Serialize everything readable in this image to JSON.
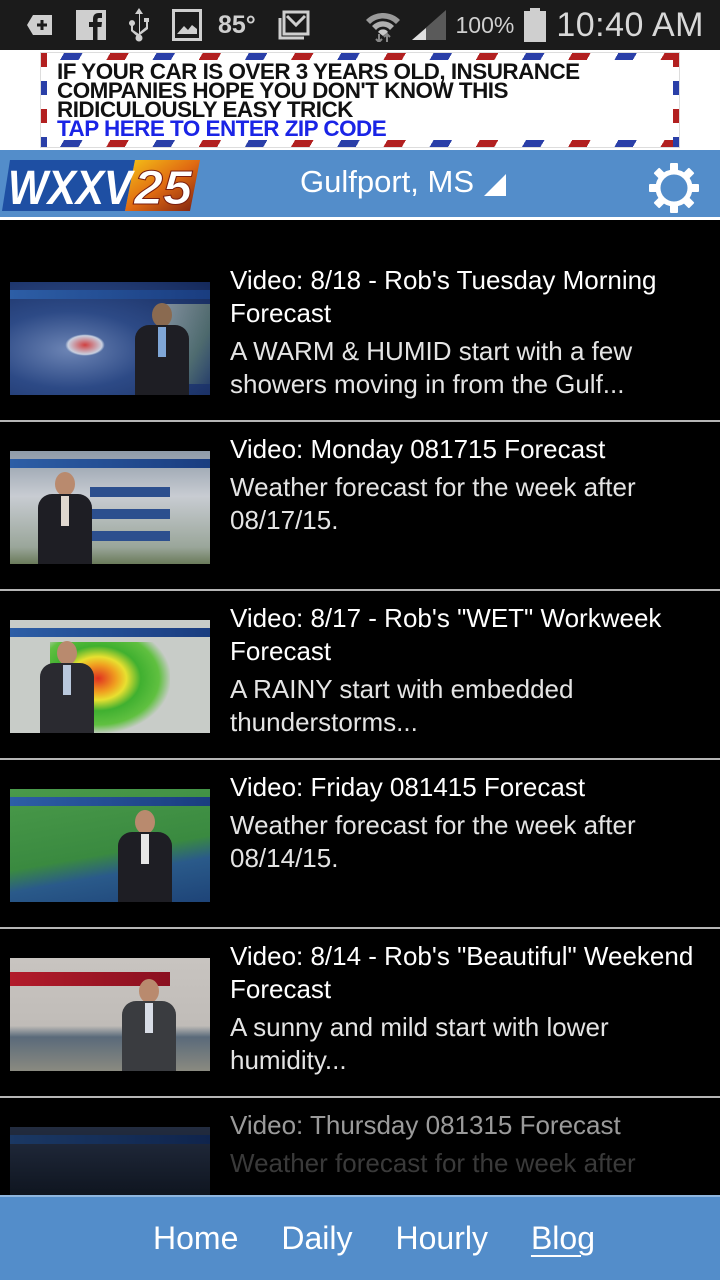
{
  "status_bar": {
    "left_icons": [
      "add-icon",
      "facebook-icon",
      "usb-icon",
      "gallery-icon"
    ],
    "temperature": "85°",
    "mail_icon": "mail-icon",
    "wifi_icon": "wifi-icon",
    "signal_icon": "signal-icon",
    "battery_percent": "100%",
    "battery_icon": "battery-icon",
    "time": "10:40 AM"
  },
  "ad": {
    "line1": "IF YOUR CAR IS OVER 3 YEARS OLD, INSURANCE",
    "line2": "COMPANIES HOPE YOU DON'T KNOW THIS",
    "line3": "RIDICULOUSLY EASY TRICK",
    "cta": "TAP HERE TO ENTER ZIP CODE"
  },
  "header": {
    "logo_text": "WXXV",
    "logo_number": "25",
    "location": "Gulfport, MS",
    "settings_icon": "gear-icon",
    "accent_color": "#538dca"
  },
  "videos": [
    {
      "title": "Video: 8/18 - Rob's Tuesday Morning Forecast",
      "description": "A WARM & HUMID start with a few showers moving in from the Gulf..."
    },
    {
      "title": "Video: Monday 081715 Forecast",
      "description": "Weather forecast for the week after 08/17/15."
    },
    {
      "title": "Video: 8/17 - Rob's \"WET\" Workweek Forecast",
      "description": "A RAINY start with embedded thunderstorms..."
    },
    {
      "title": "Video: Friday 081415 Forecast",
      "description": "Weather forecast for the week after 08/14/15."
    },
    {
      "title": "Video: 8/14 - Rob's \"Beautiful\" Weekend Forecast",
      "description": "A sunny and mild start with lower humidity..."
    },
    {
      "title": "Video: Thursday 081315 Forecast",
      "description": "Weather forecast for the week after"
    }
  ],
  "bottom_nav": {
    "items": [
      {
        "label": "Home"
      },
      {
        "label": "Daily"
      },
      {
        "label": "Hourly"
      },
      {
        "label": "Blog"
      }
    ],
    "active": "Blog"
  }
}
